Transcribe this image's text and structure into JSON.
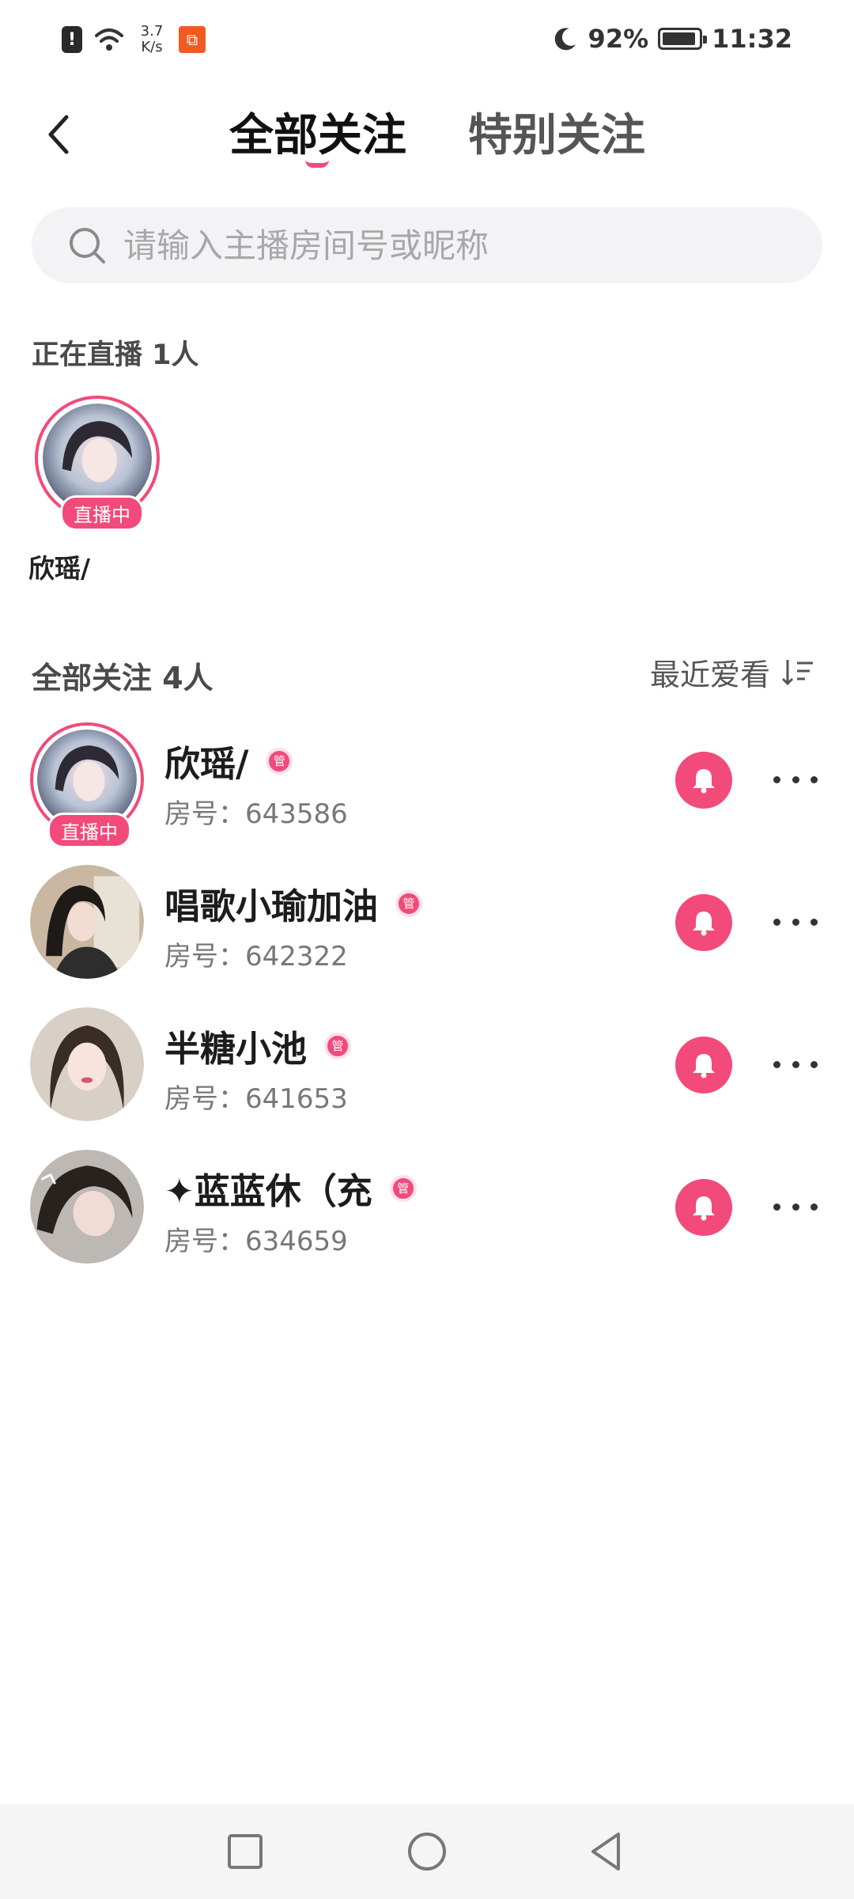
{
  "status_bar": {
    "speed_value": "3.7",
    "speed_unit": "K/s",
    "battery": "92%",
    "battery_level": 0.92,
    "time": "11:32",
    "icons": [
      "alert-icon",
      "wifi-icon",
      "app-notification-icon",
      "moon-icon",
      "battery-icon"
    ]
  },
  "header": {
    "tabs": [
      {
        "label": "全部关注",
        "active": true
      },
      {
        "label": "特别关注",
        "active": false
      }
    ]
  },
  "search": {
    "placeholder": "请输入主播房间号或昵称"
  },
  "live_section": {
    "title": "正在直播 1人",
    "items": [
      {
        "name": "欣瑶/",
        "badge": "直播中"
      }
    ]
  },
  "follow_section": {
    "title": "全部关注 4人",
    "sort_label": "最近爱看",
    "rows": [
      {
        "name": "欣瑶/",
        "room": "房号：643586",
        "live": true,
        "live_badge": "直播中",
        "role_badge": "管"
      },
      {
        "name": "唱歌小瑜加油",
        "room": "房号：642322",
        "live": false,
        "role_badge": "管"
      },
      {
        "name": "半糖小池",
        "room": "房号：641653",
        "live": false,
        "role_badge": "管"
      },
      {
        "name": "✦蓝蓝休（充",
        "room": "房号：634659",
        "live": false,
        "role_badge": "管"
      }
    ]
  },
  "colors": {
    "accent": "#f24a7a",
    "text": "#1c1c1c",
    "muted": "#777777",
    "search_bg": "#f3f3f5"
  }
}
